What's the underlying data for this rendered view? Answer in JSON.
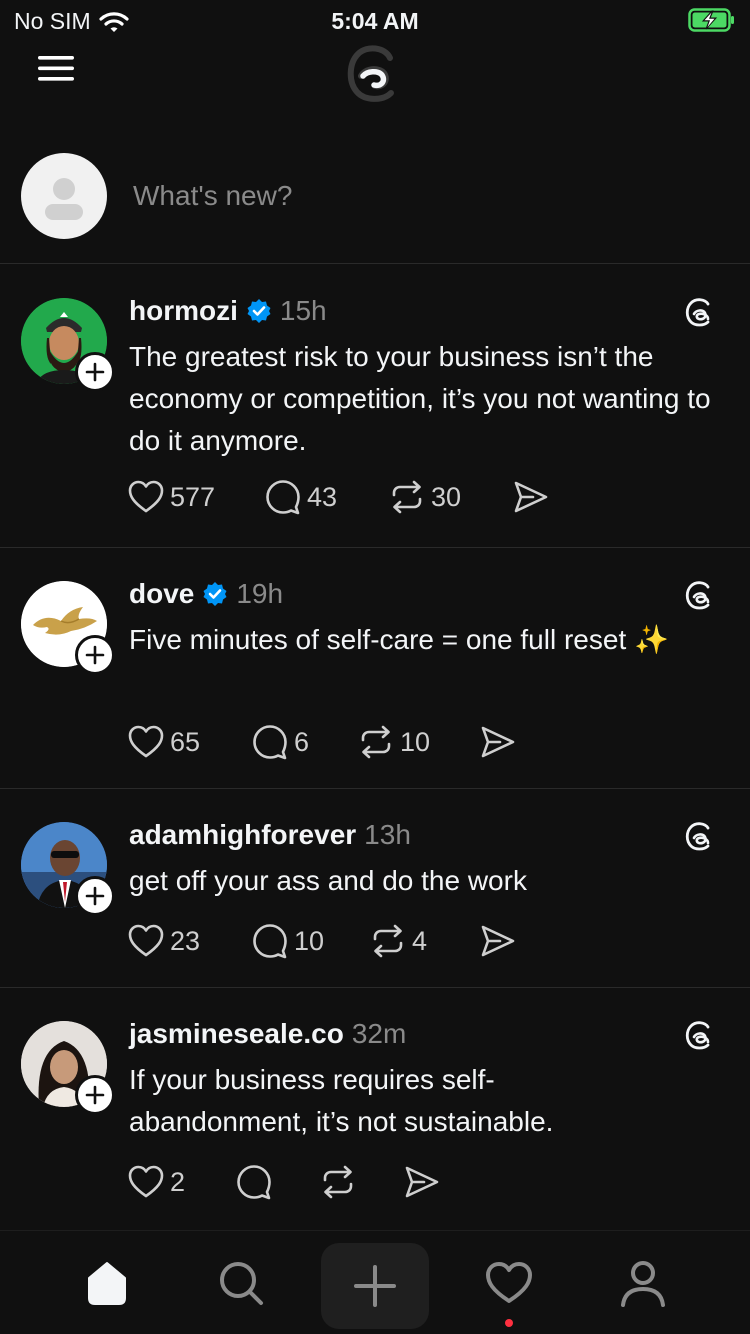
{
  "status_bar": {
    "carrier": "No SIM",
    "time": "5:04 AM"
  },
  "composer": {
    "placeholder": "What's new?"
  },
  "posts": [
    {
      "username": "hormozi",
      "verified": true,
      "time": "15h",
      "text": "The greatest risk to your business isn’t the economy or competition, it’s you not wanting to do it anymore.",
      "likes": "577",
      "replies": "43",
      "reposts": "30"
    },
    {
      "username": "dove",
      "verified": true,
      "time": "19h",
      "text": "Five minutes of self-care = one full reset ✨",
      "likes": "65",
      "replies": "6",
      "reposts": "10"
    },
    {
      "username": "adamhighforever",
      "verified": false,
      "time": "13h",
      "text": "get off your ass and do the work",
      "likes": "23",
      "replies": "10",
      "reposts": "4"
    },
    {
      "username": "jasmineseale.co",
      "verified": false,
      "time": "32m",
      "text": "If your business requires self-abandonment, it’s not sustainable.",
      "likes": "2",
      "replies": "",
      "reposts": ""
    }
  ],
  "icons": {
    "menu": "menu-icon",
    "logo": "threads-logo-icon",
    "like": "heart-icon",
    "reply": "comment-icon",
    "repost": "repost-icon",
    "share": "send-icon",
    "home": "home-icon",
    "search": "search-icon",
    "create": "plus-icon",
    "activity": "heart-icon",
    "profile": "profile-icon"
  },
  "colors": {
    "background": "#101010",
    "verified": "#0095f6",
    "notification": "#ff3040",
    "battery": "#4cd964"
  }
}
